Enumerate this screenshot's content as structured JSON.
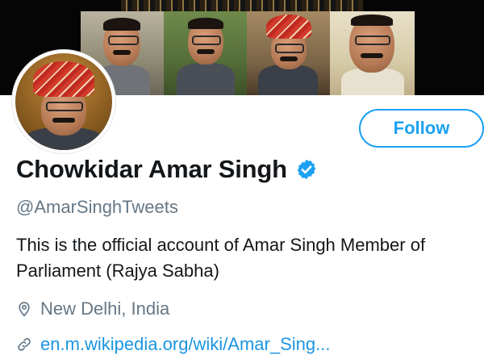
{
  "profile": {
    "display_name": "Chowkidar Amar Singh",
    "handle": "@AmarSinghTweets",
    "bio": "This is the official account of Amar Singh Member of Parliament (Rajya Sabha)",
    "location": "New Delhi, India",
    "website": "en.m.wikipedia.org/wiki/Amar_Sing...",
    "verified": true
  },
  "actions": {
    "follow_label": "Follow"
  },
  "icons": {
    "verified": "verified-badge-icon",
    "location": "location-pin-icon",
    "link": "link-icon"
  },
  "colors": {
    "accent": "#1da1f2",
    "link": "#1b95e0",
    "text_primary": "#14171a",
    "text_secondary": "#657786"
  }
}
